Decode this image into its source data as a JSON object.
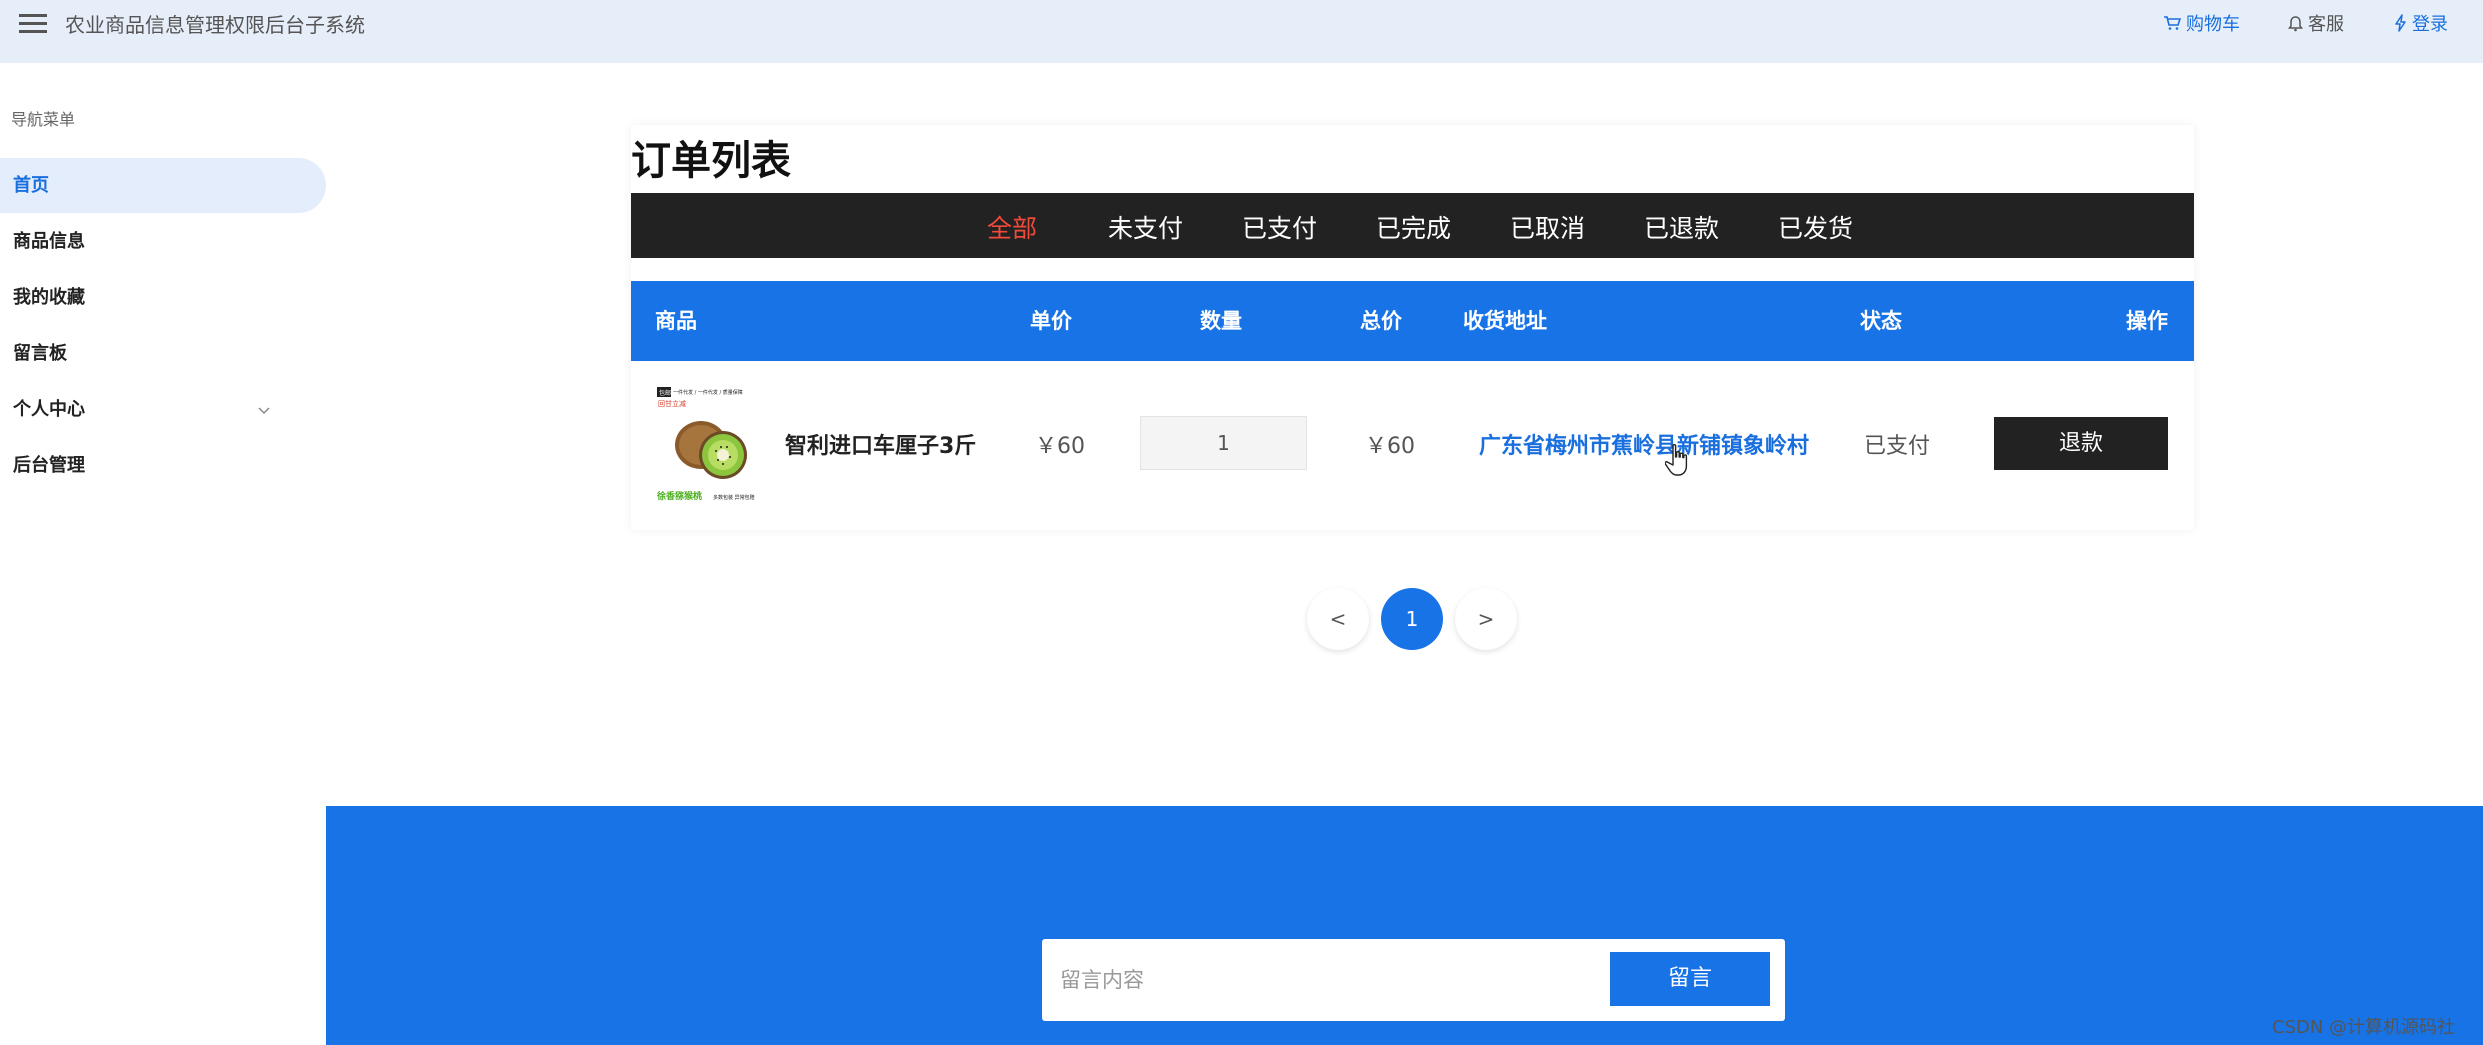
{
  "header": {
    "title": "农业商品信息管理权限后台子系统",
    "links": [
      {
        "label": "购物车",
        "icon": "cart-icon"
      },
      {
        "label": "客服",
        "icon": "bell-icon"
      },
      {
        "label": "登录",
        "icon": "lightning-icon"
      }
    ]
  },
  "sidebar": {
    "caption": "导航菜单",
    "items": [
      {
        "label": "首页",
        "active": true
      },
      {
        "label": "商品信息"
      },
      {
        "label": "我的收藏"
      },
      {
        "label": "留言板"
      },
      {
        "label": "个人中心",
        "has_submenu": true
      },
      {
        "label": "后台管理"
      }
    ]
  },
  "orders": {
    "title": "订单列表",
    "tabs": [
      "全部",
      "未支付",
      "已支付",
      "已完成",
      "已取消",
      "已退款",
      "已发货"
    ],
    "active_tab": "全部",
    "columns": [
      "商品",
      "单价",
      "数量",
      "总价",
      "收货地址",
      "状态",
      "操作"
    ],
    "rows": [
      {
        "product_name": "智利进口车厘子3斤",
        "unit_price": "￥60",
        "quantity": "1",
        "total": "￥60",
        "address": "广东省梅州市蕉岭县新铺镇象岭村",
        "status": "已支付",
        "action": "退款",
        "image_text": {
          "badge": "包邮",
          "line1": "一件代发 / 一件代发 / 质量保障",
          "line2": "回甘立减",
          "footer": "徐香猕猴桃",
          "footer_note": "多数包装 异常包赔"
        }
      }
    ]
  },
  "pagination": {
    "prev": "<",
    "current": "1",
    "next": ">"
  },
  "footer": {
    "message_placeholder": "留言内容",
    "submit_label": "留言"
  },
  "watermark": "CSDN @计算机源码社",
  "colors": {
    "primary": "#1773e6",
    "dark": "#222222",
    "active_tab": "#f04a3a",
    "header_bg": "#e6eef9",
    "sidebar_active": "#e3edfc"
  }
}
